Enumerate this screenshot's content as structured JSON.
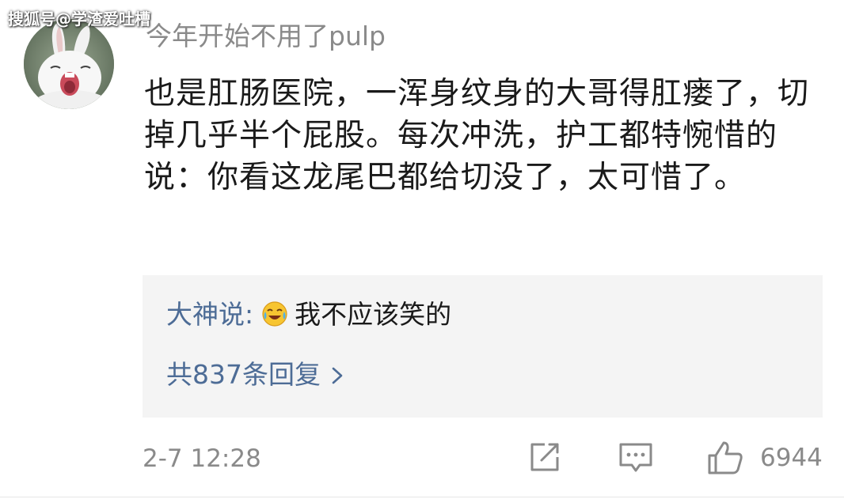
{
  "watermark": "搜狐号@学渣爱吐槽",
  "comment": {
    "username": "今年开始不用了pulp",
    "body": "也是肛肠医院，一浑身纹身的大哥得肛瘘了，切掉几乎半个屁股。每次冲洗，护工都特惋惜的说：你看这龙尾巴都给切没了，太可惜了。",
    "avatar_icon": "white-rabbit-avatar-icon"
  },
  "reply_preview": {
    "author": "大神说:",
    "emoji_icon": "laugh-cry-emoji-icon",
    "text": "我不应该笑的",
    "more_label": "共837条回复",
    "more_icon": "chevron-right-icon"
  },
  "footer": {
    "timestamp": "2-7 12:28",
    "repost_icon": "repost-edit-icon",
    "reply_icon": "comment-bubble-icon",
    "like_icon": "thumbs-up-icon",
    "like_count": "6944"
  },
  "colors": {
    "link_blue": "#4d6c96",
    "gray_text": "#8a8a8a",
    "body_text": "#1a1a1a",
    "reply_bg": "#f4f4f4"
  }
}
